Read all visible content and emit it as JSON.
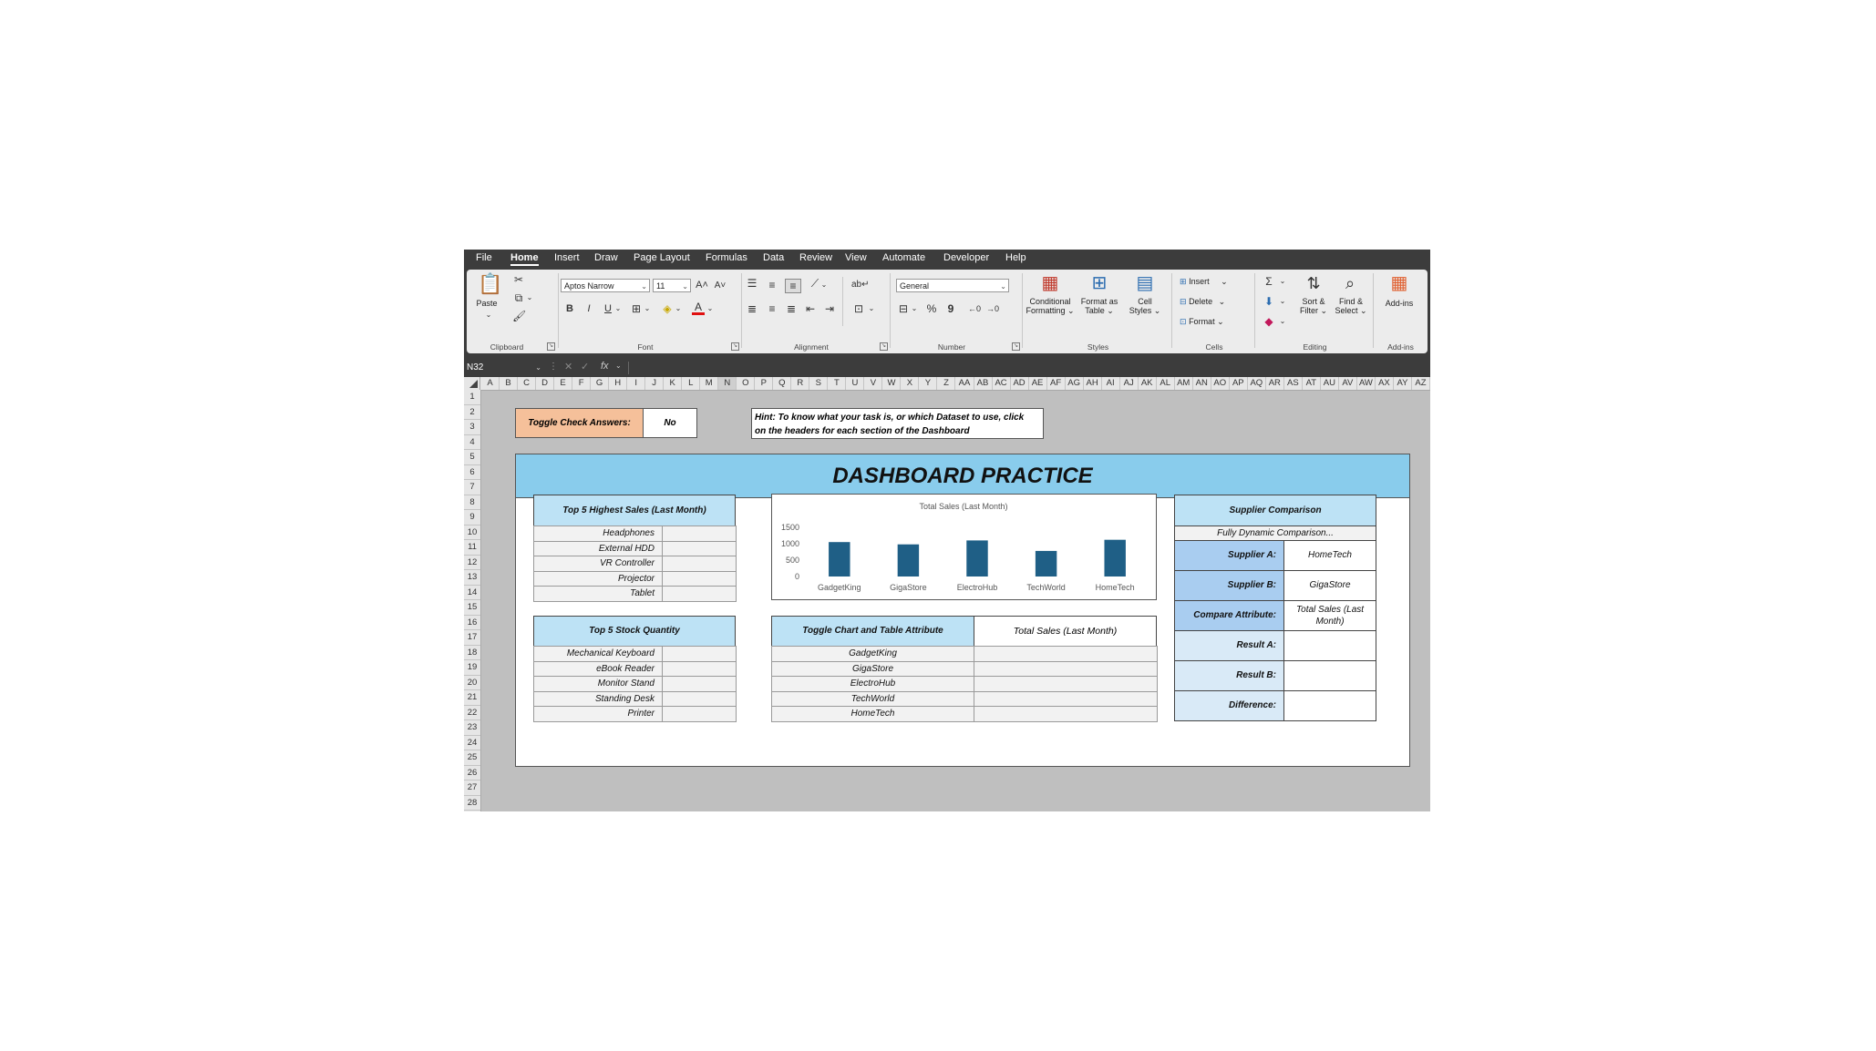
{
  "menu": [
    "File",
    "Home",
    "Insert",
    "Draw",
    "Page Layout",
    "Formulas",
    "Data",
    "Review",
    "View",
    "Automate",
    "Developer",
    "Help"
  ],
  "ribbon": {
    "paste": "Paste",
    "font_name": "Aptos Narrow",
    "font_size": "11",
    "number_format": "General",
    "cond_fmt_1": "Conditional",
    "cond_fmt_2": "Formatting",
    "fmt_table_1": "Format as",
    "fmt_table_2": "Table",
    "cell_styles_1": "Cell",
    "cell_styles_2": "Styles",
    "insert": "Insert",
    "delete": "Delete",
    "format": "Format",
    "sort_1": "Sort &",
    "sort_2": "Filter",
    "find_1": "Find &",
    "find_2": "Select",
    "addins": "Add-ins",
    "groups": {
      "clipboard": "Clipboard",
      "font": "Font",
      "alignment": "Alignment",
      "number": "Number",
      "styles": "Styles",
      "cells": "Cells",
      "editing": "Editing",
      "addins": "Add-ins"
    }
  },
  "formula_bar": {
    "name_box": "N32",
    "fx": "fx",
    "value": ""
  },
  "columns": [
    "A",
    "B",
    "C",
    "D",
    "E",
    "F",
    "G",
    "H",
    "I",
    "J",
    "K",
    "L",
    "M",
    "N",
    "O",
    "P",
    "Q",
    "R",
    "S",
    "T",
    "U",
    "V",
    "W",
    "X",
    "Y",
    "Z",
    "AA",
    "AB",
    "AC",
    "AD",
    "AE",
    "AF",
    "AG",
    "AH",
    "AI",
    "AJ",
    "AK",
    "AL",
    "AM",
    "AN",
    "AO",
    "AP",
    "AQ",
    "AR",
    "AS",
    "AT",
    "AU",
    "AV",
    "AW",
    "AX",
    "AY",
    "AZ"
  ],
  "rows": [
    "1",
    "2",
    "3",
    "4",
    "5",
    "6",
    "7",
    "8",
    "9",
    "10",
    "11",
    "12",
    "13",
    "14",
    "15",
    "16",
    "17",
    "18",
    "19",
    "20",
    "21",
    "22",
    "23",
    "24",
    "25",
    "26",
    "27",
    "28"
  ],
  "toggle": {
    "label": "Toggle Check Answers:",
    "value": "No"
  },
  "hint": {
    "line1": "Hint: To know what your task is, or which Dataset to use, click",
    "line2": "on the headers for each section of the Dashboard"
  },
  "title": "DASHBOARD PRACTICE",
  "top_sales": {
    "header": "Top 5 Highest Sales (Last Month)",
    "items": [
      "Headphones",
      "External HDD",
      "VR Controller",
      "Projector",
      "Tablet"
    ]
  },
  "top_stock": {
    "header": "Top 5 Stock Quantity",
    "items": [
      "Mechanical Keyboard",
      "eBook Reader",
      "Monitor Stand",
      "Standing Desk",
      "Printer"
    ]
  },
  "toggle_table": {
    "header": "Toggle Chart and Table Attribute",
    "attribute": "Total Sales (Last Month)",
    "items": [
      "GadgetKing",
      "GigaStore",
      "ElectroHub",
      "TechWorld",
      "HomeTech"
    ]
  },
  "supplier": {
    "header": "Supplier Comparison",
    "subheader": "Fully Dynamic Comparison...",
    "supplier_a_label": "Supplier A:",
    "supplier_a": "HomeTech",
    "supplier_b_label": "Supplier B:",
    "supplier_b": "GigaStore",
    "attr_label": "Compare Attribute:",
    "attr_line1": "Total Sales (Last",
    "attr_line2": "Month)",
    "result_a_label": "Result A:",
    "result_b_label": "Result B:",
    "difference_label": "Difference:"
  },
  "chart_data": {
    "type": "bar",
    "title": "Total Sales (Last Month)",
    "categories": [
      "GadgetKing",
      "GigaStore",
      "ElectroHub",
      "TechWorld",
      "HomeTech"
    ],
    "values": [
      1050,
      980,
      1100,
      780,
      1120
    ],
    "ylim": [
      0,
      1500
    ],
    "yticks": [
      0,
      500,
      1000,
      1500
    ],
    "xlabel": "",
    "ylabel": "",
    "color": "#1f5f86",
    "grid": false
  }
}
